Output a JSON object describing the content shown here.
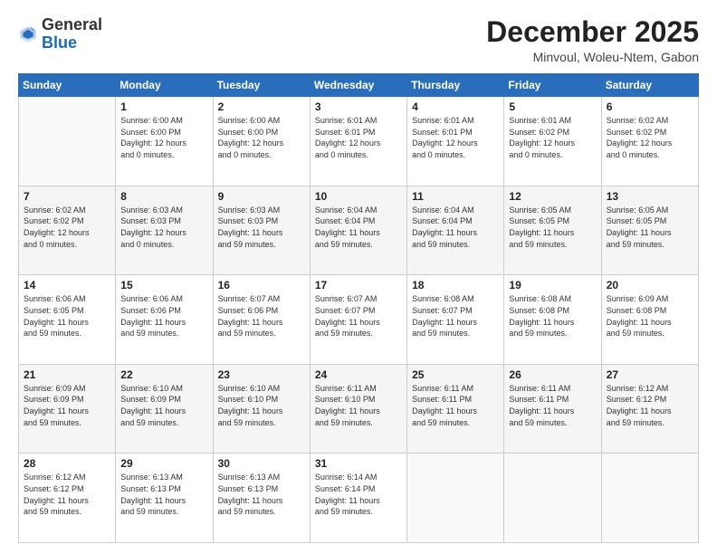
{
  "header": {
    "logo_general": "General",
    "logo_blue": "Blue",
    "month": "December 2025",
    "location": "Minvoul, Woleu-Ntem, Gabon"
  },
  "days_of_week": [
    "Sunday",
    "Monday",
    "Tuesday",
    "Wednesday",
    "Thursday",
    "Friday",
    "Saturday"
  ],
  "weeks": [
    [
      {
        "day": "",
        "info": ""
      },
      {
        "day": "1",
        "info": "Sunrise: 6:00 AM\nSunset: 6:00 PM\nDaylight: 12 hours\nand 0 minutes."
      },
      {
        "day": "2",
        "info": "Sunrise: 6:00 AM\nSunset: 6:00 PM\nDaylight: 12 hours\nand 0 minutes."
      },
      {
        "day": "3",
        "info": "Sunrise: 6:01 AM\nSunset: 6:01 PM\nDaylight: 12 hours\nand 0 minutes."
      },
      {
        "day": "4",
        "info": "Sunrise: 6:01 AM\nSunset: 6:01 PM\nDaylight: 12 hours\nand 0 minutes."
      },
      {
        "day": "5",
        "info": "Sunrise: 6:01 AM\nSunset: 6:02 PM\nDaylight: 12 hours\nand 0 minutes."
      },
      {
        "day": "6",
        "info": "Sunrise: 6:02 AM\nSunset: 6:02 PM\nDaylight: 12 hours\nand 0 minutes."
      }
    ],
    [
      {
        "day": "7",
        "info": "Sunrise: 6:02 AM\nSunset: 6:02 PM\nDaylight: 12 hours\nand 0 minutes."
      },
      {
        "day": "8",
        "info": "Sunrise: 6:03 AM\nSunset: 6:03 PM\nDaylight: 12 hours\nand 0 minutes."
      },
      {
        "day": "9",
        "info": "Sunrise: 6:03 AM\nSunset: 6:03 PM\nDaylight: 11 hours\nand 59 minutes."
      },
      {
        "day": "10",
        "info": "Sunrise: 6:04 AM\nSunset: 6:04 PM\nDaylight: 11 hours\nand 59 minutes."
      },
      {
        "day": "11",
        "info": "Sunrise: 6:04 AM\nSunset: 6:04 PM\nDaylight: 11 hours\nand 59 minutes."
      },
      {
        "day": "12",
        "info": "Sunrise: 6:05 AM\nSunset: 6:05 PM\nDaylight: 11 hours\nand 59 minutes."
      },
      {
        "day": "13",
        "info": "Sunrise: 6:05 AM\nSunset: 6:05 PM\nDaylight: 11 hours\nand 59 minutes."
      }
    ],
    [
      {
        "day": "14",
        "info": "Sunrise: 6:06 AM\nSunset: 6:05 PM\nDaylight: 11 hours\nand 59 minutes."
      },
      {
        "day": "15",
        "info": "Sunrise: 6:06 AM\nSunset: 6:06 PM\nDaylight: 11 hours\nand 59 minutes."
      },
      {
        "day": "16",
        "info": "Sunrise: 6:07 AM\nSunset: 6:06 PM\nDaylight: 11 hours\nand 59 minutes."
      },
      {
        "day": "17",
        "info": "Sunrise: 6:07 AM\nSunset: 6:07 PM\nDaylight: 11 hours\nand 59 minutes."
      },
      {
        "day": "18",
        "info": "Sunrise: 6:08 AM\nSunset: 6:07 PM\nDaylight: 11 hours\nand 59 minutes."
      },
      {
        "day": "19",
        "info": "Sunrise: 6:08 AM\nSunset: 6:08 PM\nDaylight: 11 hours\nand 59 minutes."
      },
      {
        "day": "20",
        "info": "Sunrise: 6:09 AM\nSunset: 6:08 PM\nDaylight: 11 hours\nand 59 minutes."
      }
    ],
    [
      {
        "day": "21",
        "info": "Sunrise: 6:09 AM\nSunset: 6:09 PM\nDaylight: 11 hours\nand 59 minutes."
      },
      {
        "day": "22",
        "info": "Sunrise: 6:10 AM\nSunset: 6:09 PM\nDaylight: 11 hours\nand 59 minutes."
      },
      {
        "day": "23",
        "info": "Sunrise: 6:10 AM\nSunset: 6:10 PM\nDaylight: 11 hours\nand 59 minutes."
      },
      {
        "day": "24",
        "info": "Sunrise: 6:11 AM\nSunset: 6:10 PM\nDaylight: 11 hours\nand 59 minutes."
      },
      {
        "day": "25",
        "info": "Sunrise: 6:11 AM\nSunset: 6:11 PM\nDaylight: 11 hours\nand 59 minutes."
      },
      {
        "day": "26",
        "info": "Sunrise: 6:11 AM\nSunset: 6:11 PM\nDaylight: 11 hours\nand 59 minutes."
      },
      {
        "day": "27",
        "info": "Sunrise: 6:12 AM\nSunset: 6:12 PM\nDaylight: 11 hours\nand 59 minutes."
      }
    ],
    [
      {
        "day": "28",
        "info": "Sunrise: 6:12 AM\nSunset: 6:12 PM\nDaylight: 11 hours\nand 59 minutes."
      },
      {
        "day": "29",
        "info": "Sunrise: 6:13 AM\nSunset: 6:13 PM\nDaylight: 11 hours\nand 59 minutes."
      },
      {
        "day": "30",
        "info": "Sunrise: 6:13 AM\nSunset: 6:13 PM\nDaylight: 11 hours\nand 59 minutes."
      },
      {
        "day": "31",
        "info": "Sunrise: 6:14 AM\nSunset: 6:14 PM\nDaylight: 11 hours\nand 59 minutes."
      },
      {
        "day": "",
        "info": ""
      },
      {
        "day": "",
        "info": ""
      },
      {
        "day": "",
        "info": ""
      }
    ]
  ]
}
